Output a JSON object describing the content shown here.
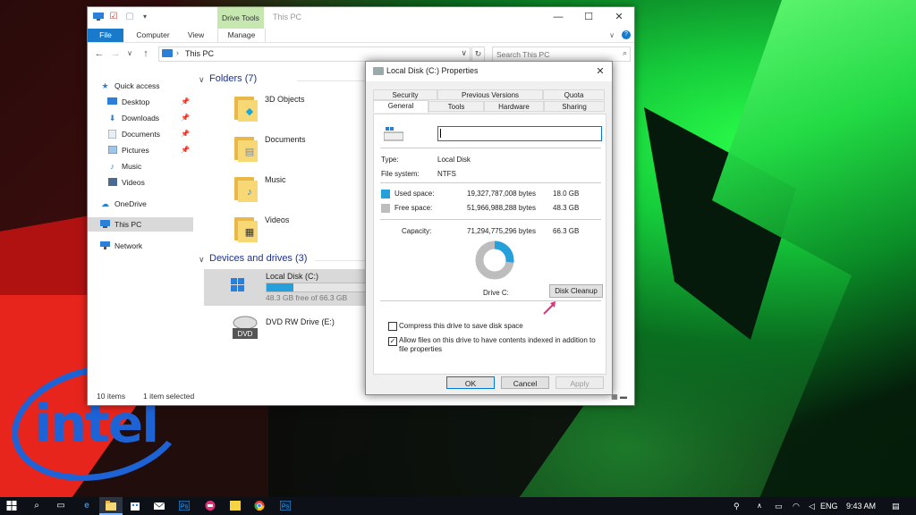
{
  "explorer": {
    "title": "This PC",
    "contextual_tab_group": "Drive Tools",
    "tabs": [
      "File",
      "Computer",
      "View",
      "Manage"
    ],
    "address": "This PC",
    "search_placeholder": "Search This PC",
    "nav": {
      "quick_access": "Quick access",
      "items": [
        "Desktop",
        "Downloads",
        "Documents",
        "Pictures",
        "Music",
        "Videos"
      ],
      "onedrive": "OneDrive",
      "this_pc": "This PC",
      "network": "Network"
    },
    "folders_header": "Folders (7)",
    "folders": [
      "3D Objects",
      "Documents",
      "Music",
      "Videos"
    ],
    "devices_header": "Devices and drives (3)",
    "drive_c": {
      "name": "Local Disk (C:)",
      "free_text": "48.3 GB free of 66.3 GB",
      "used_fraction": 0.27
    },
    "drive_e": {
      "name": "DVD RW Drive (E:)",
      "badge": "DVD"
    },
    "status": {
      "items": "10 items",
      "selected": "1 item selected"
    }
  },
  "properties": {
    "title": "Local Disk (C:) Properties",
    "tabs_row1": [
      "Security",
      "Previous Versions",
      "Quota"
    ],
    "tabs_row2": [
      "General",
      "Tools",
      "Hardware",
      "Sharing"
    ],
    "type_label": "Type:",
    "type_value": "Local Disk",
    "fs_label": "File system:",
    "fs_value": "NTFS",
    "used_label": "Used space:",
    "used_bytes": "19,327,787,008 bytes",
    "used_gb": "18.0 GB",
    "free_label": "Free space:",
    "free_bytes": "51,966,988,288 bytes",
    "free_gb": "48.3 GB",
    "capacity_label": "Capacity:",
    "capacity_bytes": "71,294,775,296 bytes",
    "capacity_gb": "66.3 GB",
    "drive_label": "Drive C:",
    "disk_cleanup": "Disk Cleanup",
    "compress_label": "Compress this drive to save disk space",
    "compress_checked": false,
    "index_label_1": "Allow files on this drive to have contents indexed in addition to",
    "index_label_2": "file properties",
    "index_checked": true,
    "ok": "OK",
    "cancel": "Cancel",
    "apply": "Apply",
    "used_color": "#26a0da",
    "free_color": "#bdbdbd"
  },
  "taskbar": {
    "language": "ENG",
    "time": "9:43 AM"
  }
}
